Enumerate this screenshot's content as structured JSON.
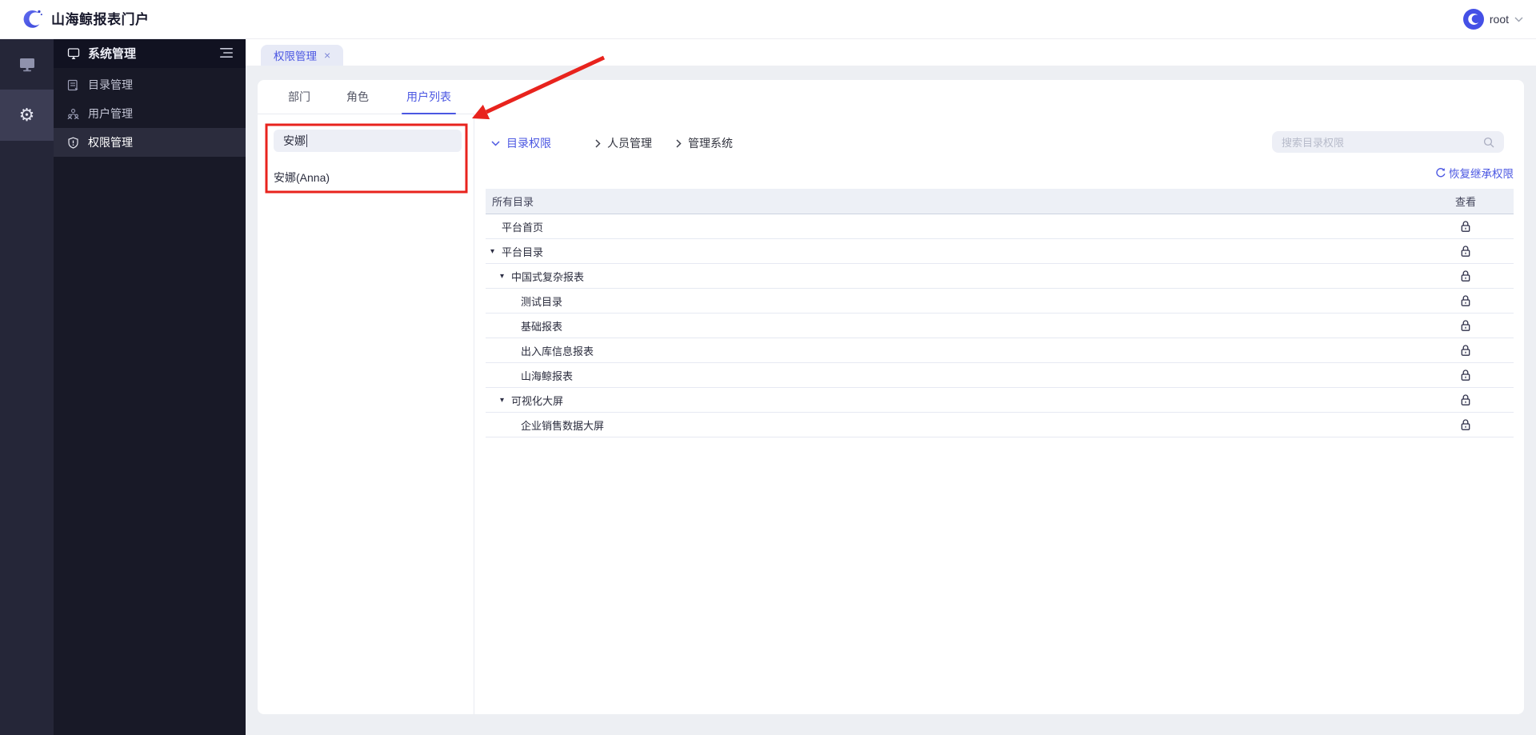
{
  "topbar": {
    "title": "山海鲸报表门户",
    "user": "root"
  },
  "sidebar": {
    "header": "系统管理",
    "items": [
      {
        "label": "目录管理"
      },
      {
        "label": "用户管理"
      },
      {
        "label": "权限管理"
      }
    ]
  },
  "tabstrip": {
    "label": "权限管理",
    "close": "×"
  },
  "user_tabs": {
    "items": [
      {
        "label": "部门"
      },
      {
        "label": "角色"
      },
      {
        "label": "用户列表"
      }
    ]
  },
  "user_panel": {
    "search_value": "安娜",
    "result": "安娜(Anna)"
  },
  "perm_panel": {
    "sections": [
      {
        "label": "目录权限"
      },
      {
        "label": "人员管理"
      },
      {
        "label": "管理系统"
      }
    ],
    "search_placeholder": "搜索目录权限",
    "restore_label": "恢复继承权限",
    "table": {
      "header": "所有目录",
      "view_header": "查看",
      "rows": [
        {
          "label": "平台首页",
          "level": 0,
          "expandable": false
        },
        {
          "label": "平台目录",
          "level": 0,
          "expandable": true
        },
        {
          "label": "中国式复杂报表",
          "level": 1,
          "expandable": true
        },
        {
          "label": "测试目录",
          "level": 2,
          "expandable": false
        },
        {
          "label": "基础报表",
          "level": 2,
          "expandable": false
        },
        {
          "label": "出入库信息报表",
          "level": 2,
          "expandable": false
        },
        {
          "label": "山海鲸报表",
          "level": 2,
          "expandable": false
        },
        {
          "label": "可视化大屏",
          "level": 1,
          "expandable": true
        },
        {
          "label": "企业销售数据大屏",
          "level": 2,
          "expandable": false
        }
      ]
    }
  },
  "icons": {
    "gear_glyph": "⚙",
    "tree_caret": "▾"
  },
  "colors": {
    "accent": "#4b57e2",
    "annotation_red": "#e8231d",
    "rail_bg": "#252638",
    "sidebar_bg": "#181927"
  }
}
